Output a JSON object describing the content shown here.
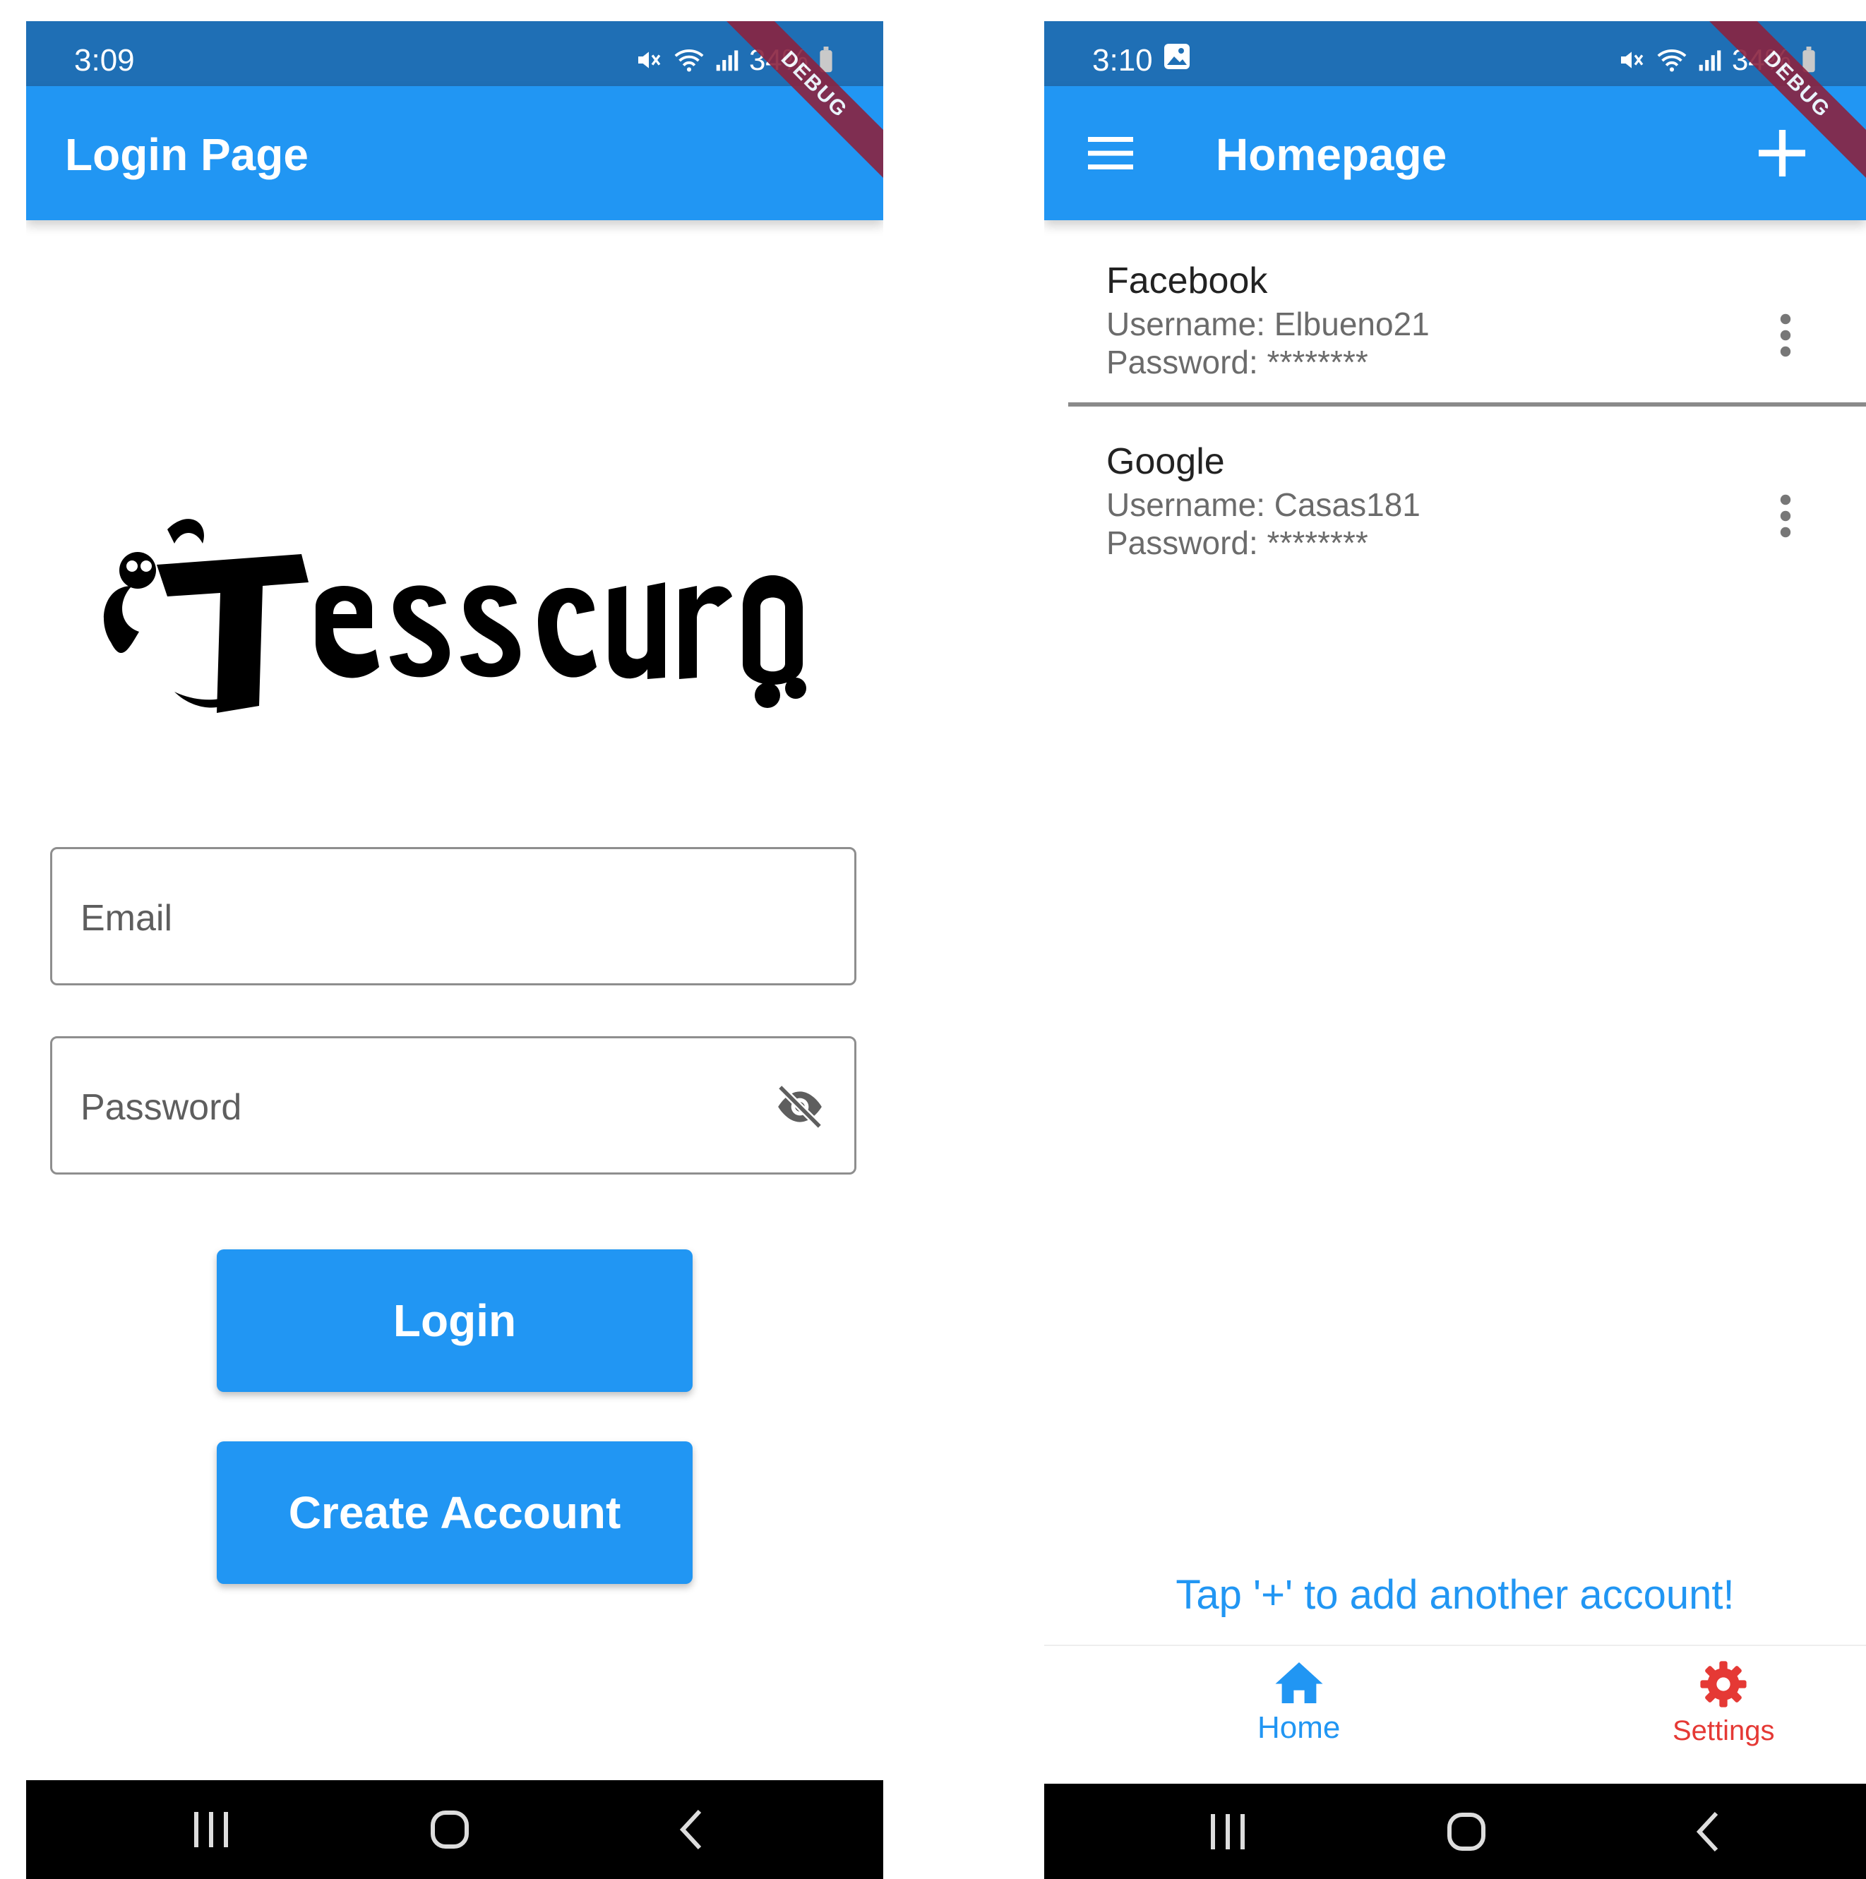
{
  "login": {
    "status_time": "3:09",
    "battery": "34%",
    "debug_banner": "DEBUG",
    "title": "Login Page",
    "email_placeholder": "Email",
    "password_placeholder": "Password",
    "login_label": "Login",
    "create_account_label": "Create Account",
    "logo_text": "Tesscuro"
  },
  "home": {
    "status_time": "3:10",
    "battery": "34%",
    "debug_banner": "DEBUG",
    "title": "Homepage",
    "entries": [
      {
        "name": "Facebook",
        "username": "Username: Elbueno21",
        "password": "Password: ********"
      },
      {
        "name": "Google",
        "username": "Username: Casas181",
        "password": "Password: ********"
      }
    ],
    "hint": "Tap '+' to add another account!",
    "nav": {
      "home_label": "Home",
      "settings_label": "Settings"
    }
  },
  "colors": {
    "status_bar": "#1f6fb5",
    "app_bar": "#2196f3",
    "primary": "#2196f3",
    "settings_accent": "#e53935",
    "debug_band": "#8a2340"
  },
  "icons": [
    "mute-icon",
    "wifi-icon",
    "signal-icon",
    "battery-icon",
    "image-notification-icon",
    "visibility-off-icon",
    "menu-icon",
    "add-icon",
    "more-vert-icon",
    "home-icon",
    "settings-gear-icon",
    "recents-icon",
    "home-nav-icon",
    "back-icon"
  ]
}
